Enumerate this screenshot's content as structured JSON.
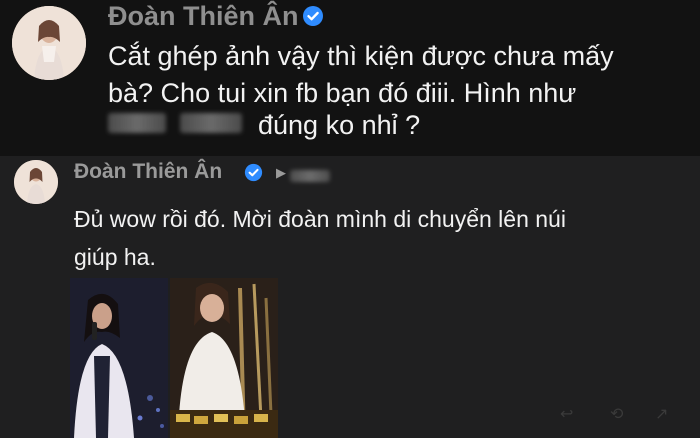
{
  "top_post": {
    "username": "Đoàn Thiên Ân",
    "body_line1": "Cắt ghép ảnh vậy thì kiện được chưa mấy",
    "body_line2": "bà? Cho tui xin fb bạn đó điii. Hình như",
    "body_tail": "đúng ko nhỉ ?"
  },
  "bottom_post": {
    "username": "Đoàn Thiên Ân",
    "body_line1": "Đủ wow rồi đó. Mời đoàn mình di chuyển lên núi",
    "body_line2": "giúp ha."
  },
  "colors": {
    "verified": "#2f8cff",
    "top_bg": "#121212",
    "bottom_bg": "#1f1f20"
  },
  "icons": {
    "verified": "verified-badge-icon",
    "play": "play-icon"
  }
}
